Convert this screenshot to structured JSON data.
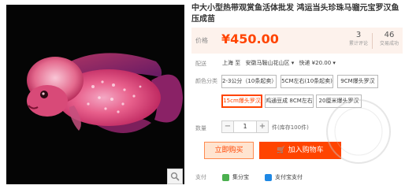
{
  "product": {
    "title": "中大小型热带观赏鱼活体批发 鸿运当头珍珠马骝元宝罗汉鱼压成苗"
  },
  "price": {
    "label": "价格",
    "value": "¥450.00",
    "reviews_count": "3",
    "reviews_label": "累计评论",
    "sales_count": "46",
    "sales_label": "交易成功"
  },
  "shipping": {
    "label": "配送",
    "from": "上海 至",
    "to": "安徽马鞍山花山区 ▾",
    "method": "快递 ¥20.00 ▾"
  },
  "color": {
    "label": "颜色分类",
    "options": [
      "2-3公分（10条起卖）",
      "5CM左右(10条起卖)",
      "9CM爆头罗汉",
      "15cm爆头罗汉",
      "鸡通豆成 8CM左右",
      "20厘米爆头罗汉"
    ],
    "selected_index": 3
  },
  "quantity": {
    "label": "数量",
    "minus": "−",
    "value": "1",
    "plus": "+",
    "stock": "件(库存100件)"
  },
  "actions": {
    "buy_now": "立即购买",
    "cart_icon": "🛒",
    "add_to_cart": "加入购物车"
  },
  "payment": {
    "label": "支付",
    "methods": [
      "集分宝",
      "支付宝支付"
    ]
  },
  "icons": {
    "zoom": "magnifier-icon",
    "cart": "cart-icon"
  },
  "colors": {
    "accent": "#ff4400",
    "price_bg": "#fdf2ec"
  }
}
